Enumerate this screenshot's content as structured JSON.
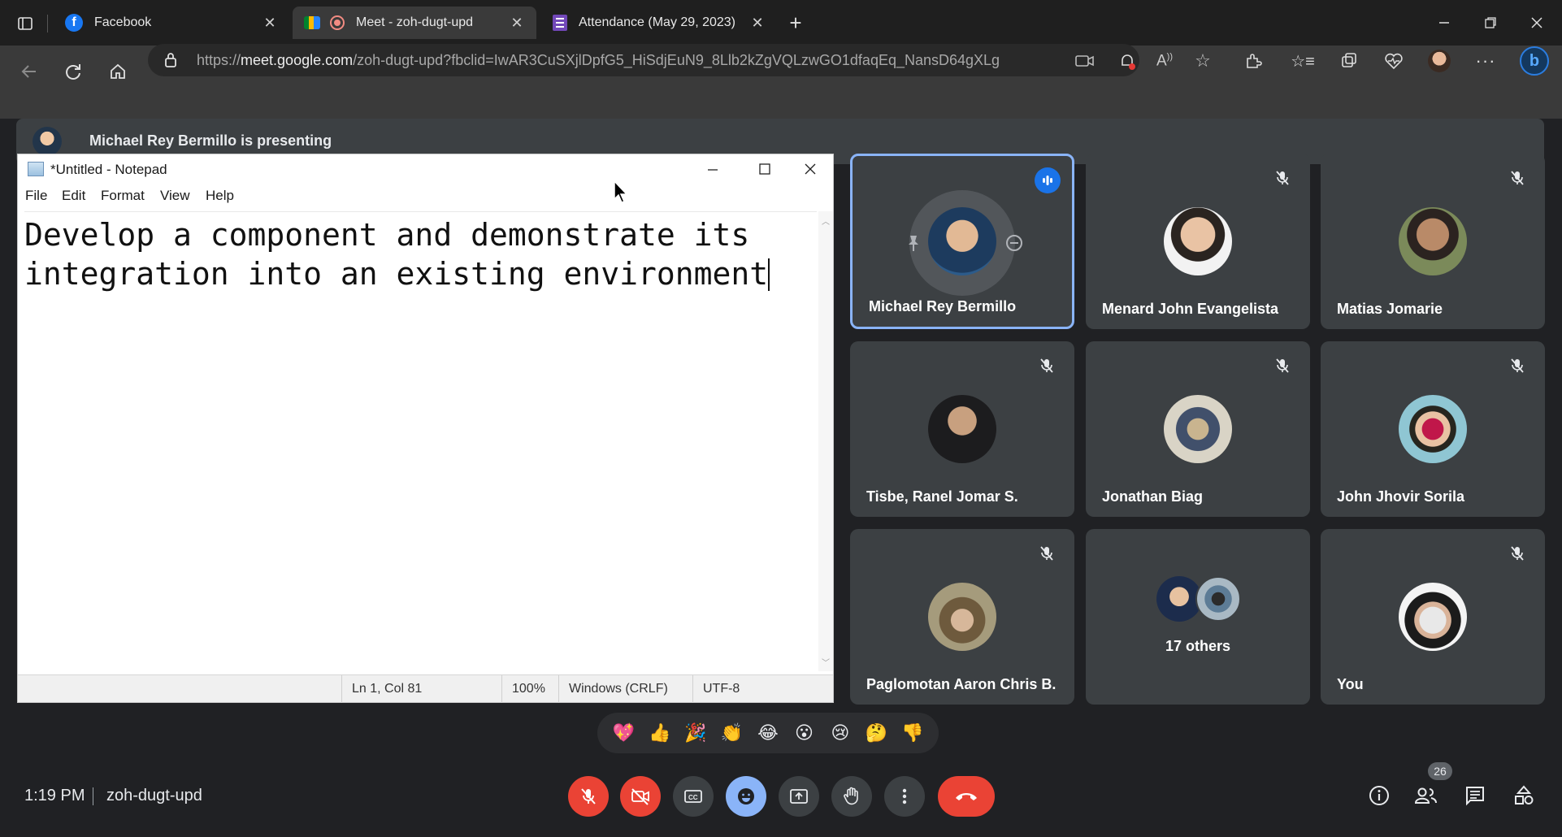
{
  "browser": {
    "tabs": [
      {
        "title": "Facebook"
      },
      {
        "title": "Meet - zoh-dugt-upd"
      },
      {
        "title": "Attendance (May 29, 2023)"
      }
    ],
    "url": {
      "prefix": "https://",
      "host": "meet.google.com",
      "path": "/zoh-dugt-upd?fbclid=IwAR3CuSXjlDpfG5_HiSdjEuN9_8Llb2kZgVQLzwGO1dfaqEq_NansD64gXLg"
    }
  },
  "presenting": {
    "text": "Michael Rey Bermillo is presenting"
  },
  "notepad": {
    "title": "*Untitled - Notepad",
    "menu": [
      "File",
      "Edit",
      "Format",
      "View",
      "Help"
    ],
    "content_line1": "Develop a component and demonstrate its",
    "content_line2": "integration into an existing environment",
    "status": {
      "position": "Ln 1, Col 81",
      "zoom": "100%",
      "line_ending": "Windows (CRLF)",
      "encoding": "UTF-8"
    }
  },
  "participants": [
    {
      "name": "Michael Rey Bermillo",
      "speaking": true
    },
    {
      "name": "Menard John Evangelista",
      "muted": true
    },
    {
      "name": "Matias Jomarie",
      "muted": true
    },
    {
      "name": "Tisbe, Ranel Jomar S.",
      "muted": true
    },
    {
      "name": "Jonathan Biag",
      "muted": true
    },
    {
      "name": "John Jhovir Sorila",
      "muted": true
    },
    {
      "name": "Paglomotan Aaron Chris B.",
      "muted": true
    },
    {
      "name": "17 others"
    },
    {
      "name": "You",
      "muted": true
    }
  ],
  "reactions": [
    "💖",
    "👍",
    "🎉",
    "👏",
    "😂",
    "😮",
    "😢",
    "🤔",
    "👎"
  ],
  "bottom_bar": {
    "time": "1:19 PM",
    "meeting_code": "zoh-dugt-upd",
    "people_count": "26"
  },
  "colors": {
    "background": "#202124",
    "tile": "#3c4043",
    "accent_blue": "#8ab4f8",
    "red": "#ea4335"
  }
}
